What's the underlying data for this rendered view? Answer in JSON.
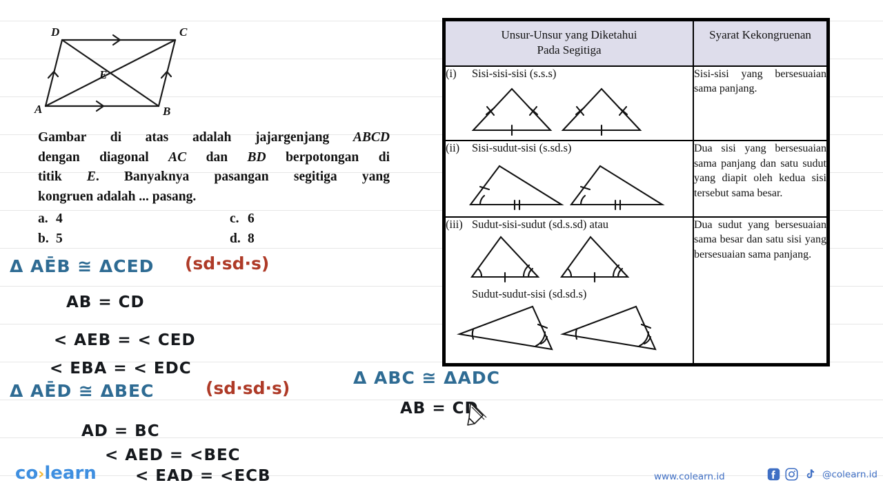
{
  "figure": {
    "name": "parallelogram-abcd",
    "vertices": {
      "A": "A",
      "B": "B",
      "C": "C",
      "D": "D",
      "E": "E"
    }
  },
  "question": {
    "line1": "Gambar di atas adalah jajargenjang ABCD",
    "line2": "dengan diagonal AC dan BD berpotongan di",
    "line3": "titik E. Banyaknya pasangan segitiga yang",
    "line4": "kongruen adalah ... pasang.",
    "choices": [
      {
        "label": "a.",
        "value": "4"
      },
      {
        "label": "b.",
        "value": "5"
      },
      {
        "label": "c.",
        "value": "6"
      },
      {
        "label": "d.",
        "value": "8"
      }
    ]
  },
  "table": {
    "header_left": "Unsur-Unsur yang Diketahui Pada Segitiga",
    "header_left_line1": "Unsur-Unsur yang Diketahui",
    "header_left_line2": "Pada Segitiga",
    "header_right": "Syarat Kekongruenan",
    "rows": [
      {
        "num": "(i)",
        "criterion": "Sisi-sisi-sisi (s.s.s)",
        "description": "Sisi-sisi yang bersesuaian sama panjang."
      },
      {
        "num": "(ii)",
        "criterion": "Sisi-sudut-sisi (s.sd.s)",
        "description": "Dua sisi yang bersesuaian sama panjang dan satu sudut yang diapit  oleh kedua sisi tersebut sama besar."
      },
      {
        "num": "(iii)",
        "criterion": "Sudut-sisi-sudut (sd.s.sd) atau",
        "criterion_alt": "Sudut-sudut-sisi (sd.sd.s)",
        "description": "Dua sudut yang bersesuaian sama besar dan satu sisi yang bersesuaian sama panjang."
      }
    ]
  },
  "annotations": {
    "left": [
      {
        "id": "ann-1-statement",
        "text": "Δ AĒB  ≅  ΔCED",
        "color": "blue"
      },
      {
        "id": "ann-1-reason",
        "text": "(sd·sd·s)",
        "color": "red"
      },
      {
        "id": "ann-1-a",
        "text": "AB  =  CD",
        "color": "black"
      },
      {
        "id": "ann-1-b",
        "text": "<  AEB   =  < CED",
        "color": "black"
      },
      {
        "id": "ann-1-c",
        "text": "<  EBA   =  < EDC",
        "color": "black"
      },
      {
        "id": "ann-2-statement",
        "text": "Δ AĒD  ≅  ΔBEC",
        "color": "blue"
      },
      {
        "id": "ann-2-reason",
        "text": "(sd·sd·s)",
        "color": "red"
      },
      {
        "id": "ann-2-a",
        "text": "AD  =  BC",
        "color": "black"
      },
      {
        "id": "ann-2-b",
        "text": "<  AED  = <BEC",
        "color": "black"
      },
      {
        "id": "ann-2-c",
        "text": "<  EAD  = <ECB",
        "color": "black"
      }
    ],
    "right": [
      {
        "id": "ann-3-statement",
        "text": "Δ ABC  ≅  ΔADC",
        "color": "blue"
      },
      {
        "id": "ann-3-a",
        "text": "AB  =  CD",
        "color": "black"
      }
    ]
  },
  "footer": {
    "logo_left": "co",
    "logo_dot": "›",
    "logo_right": "learn",
    "website": "www.colearn.id",
    "handle": "@colearn.id",
    "social_icons": [
      "facebook-icon",
      "instagram-icon",
      "tiktok-icon"
    ]
  },
  "cursor": {
    "type": "pencil-cursor"
  },
  "colors": {
    "ink_blue": "#2e6b93",
    "ink_red": "#ae3a27",
    "ink_black": "#15181c",
    "table_header_bg": "#deddeb",
    "brand_blue": "#3f8fe0",
    "brand_yellow": "#f5b731",
    "link_blue": "#3f6fc4"
  }
}
